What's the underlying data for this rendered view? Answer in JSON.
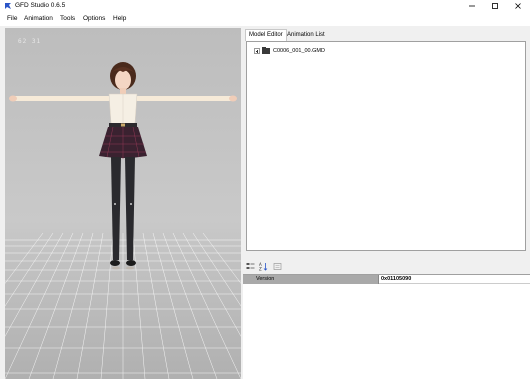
{
  "window": {
    "title": "GFD Studio 0.6.5",
    "icons": {
      "app": "gfd-app-icon",
      "minimize": "minimize-icon",
      "maximize": "maximize-icon",
      "close": "close-icon"
    }
  },
  "menu": {
    "items": [
      "File",
      "Animation",
      "Tools",
      "Options",
      "Help"
    ]
  },
  "viewport": {
    "fps_readout": "62 31",
    "background_color": "#c4c4c4",
    "grid_color": "#ffffff"
  },
  "tabs": {
    "active": "Model Editor",
    "items": [
      "Model Editor",
      "Animation List"
    ]
  },
  "tree": {
    "root_label": "C0006_001_00.GMD",
    "expanded": false
  },
  "property_toolbar": {
    "icons": [
      "categorized-icon",
      "alphabetical-icon",
      "property-pages-icon"
    ]
  },
  "properties": {
    "rows": [
      {
        "name": "Version",
        "value": "0x01105090"
      }
    ]
  }
}
